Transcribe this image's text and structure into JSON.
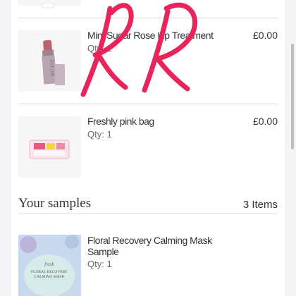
{
  "cart_items": [
    {
      "name": "Mini Sugar Rose Lip Treatment",
      "qty": "Qty: 1",
      "price": "£0.00",
      "thumb_icon": "lip-treatment-icon"
    },
    {
      "name": "Freshly pink bag",
      "qty": "Qty: 1",
      "price": "£0.00",
      "thumb_icon": "pink-bag-icon"
    }
  ],
  "samples": {
    "title": "Your samples",
    "count": "3 Items",
    "items": [
      {
        "name": "Floral Recovery Calming Mask Sample",
        "qty": "Qty: 1",
        "thumb_icon": "mask-jar-icon",
        "brand_text": "fresh",
        "product_text": "FLORAL RECOVERY CALMING MASK"
      }
    ]
  },
  "annotation": {
    "text": "RR",
    "color": "#e8245a"
  },
  "colors": {
    "background": "#f4f4f6",
    "panel": "#ffffff",
    "divider": "#dcdcdc"
  }
}
